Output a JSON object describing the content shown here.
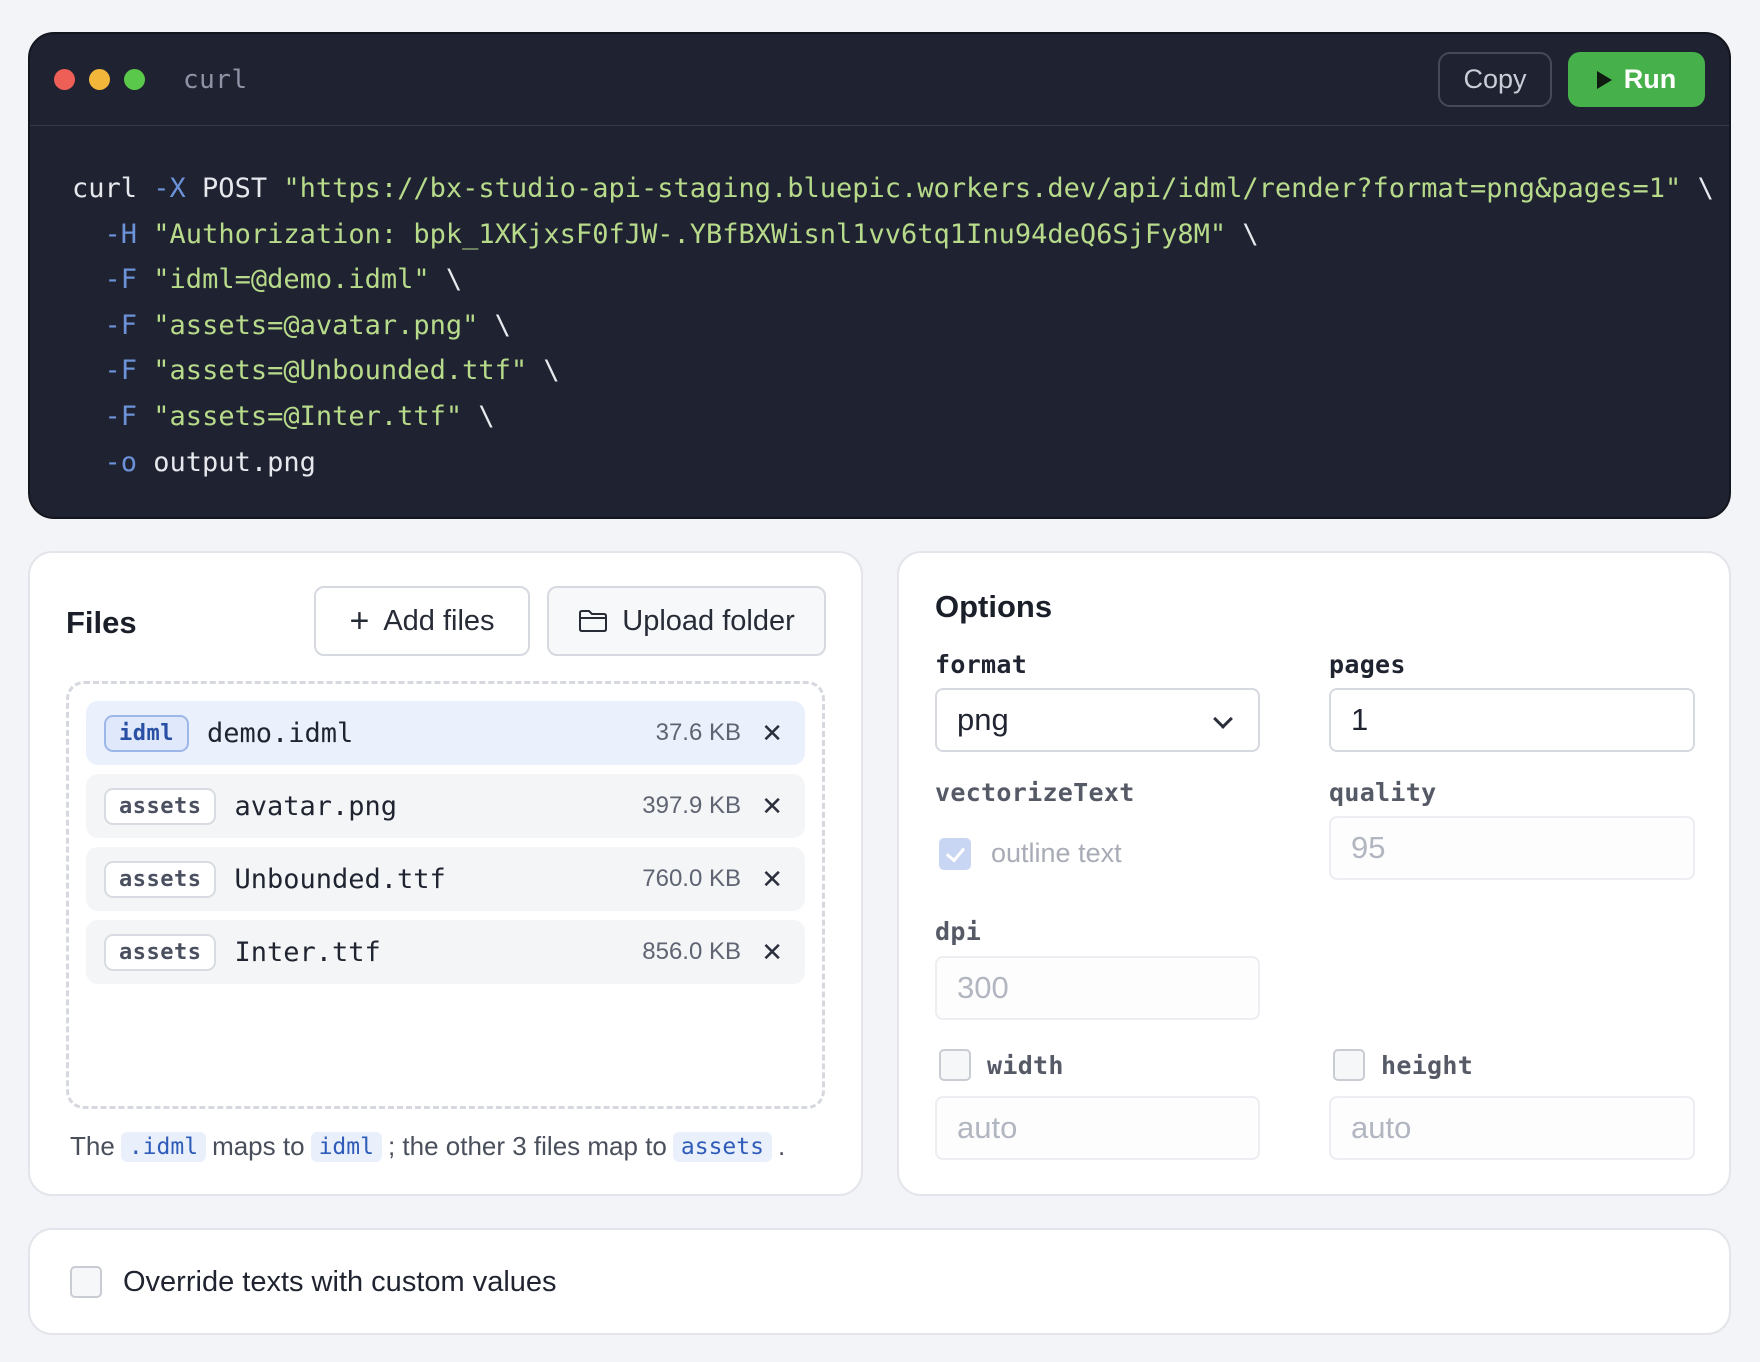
{
  "terminal": {
    "title": "curl",
    "copy_label": "Copy",
    "run_label": "Run",
    "code_lines": [
      [
        {
          "t": "curl ",
          "c": "plain"
        },
        {
          "t": "-X",
          "c": "flag"
        },
        {
          "t": " POST ",
          "c": "plain"
        },
        {
          "t": "\"https://bx-studio-api-staging.bluepic.workers.dev/api/idml/render?format=png&pages=1\"",
          "c": "str"
        },
        {
          "t": " \\",
          "c": "plain"
        }
      ],
      [
        {
          "t": "  ",
          "c": "plain"
        },
        {
          "t": "-H",
          "c": "flag"
        },
        {
          "t": " ",
          "c": "plain"
        },
        {
          "t": "\"Authorization: bpk_1XKjxsF0fJW-.YBfBXWisnl1vv6tq1Inu94deQ6SjFy8M\"",
          "c": "str"
        },
        {
          "t": " \\",
          "c": "plain"
        }
      ],
      [
        {
          "t": "  ",
          "c": "plain"
        },
        {
          "t": "-F",
          "c": "flag"
        },
        {
          "t": " ",
          "c": "plain"
        },
        {
          "t": "\"idml=@demo.idml\"",
          "c": "str"
        },
        {
          "t": " \\",
          "c": "plain"
        }
      ],
      [
        {
          "t": "  ",
          "c": "plain"
        },
        {
          "t": "-F",
          "c": "flag"
        },
        {
          "t": " ",
          "c": "plain"
        },
        {
          "t": "\"assets=@avatar.png\"",
          "c": "str"
        },
        {
          "t": " \\",
          "c": "plain"
        }
      ],
      [
        {
          "t": "  ",
          "c": "plain"
        },
        {
          "t": "-F",
          "c": "flag"
        },
        {
          "t": " ",
          "c": "plain"
        },
        {
          "t": "\"assets=@Unbounded.ttf\"",
          "c": "str"
        },
        {
          "t": " \\",
          "c": "plain"
        }
      ],
      [
        {
          "t": "  ",
          "c": "plain"
        },
        {
          "t": "-F",
          "c": "flag"
        },
        {
          "t": " ",
          "c": "plain"
        },
        {
          "t": "\"assets=@Inter.ttf\"",
          "c": "str"
        },
        {
          "t": " \\",
          "c": "plain"
        }
      ],
      [
        {
          "t": "  ",
          "c": "plain"
        },
        {
          "t": "-o",
          "c": "flag"
        },
        {
          "t": " output.png",
          "c": "plain"
        }
      ]
    ]
  },
  "files": {
    "title": "Files",
    "add_label": "Add files",
    "upload_label": "Upload folder",
    "items": [
      {
        "badge": "idml",
        "name": "demo.idml",
        "size": "37.6 KB"
      },
      {
        "badge": "assets",
        "name": "avatar.png",
        "size": "397.9 KB"
      },
      {
        "badge": "assets",
        "name": "Unbounded.ttf",
        "size": "760.0 KB"
      },
      {
        "badge": "assets",
        "name": "Inter.ttf",
        "size": "856.0 KB"
      }
    ],
    "note": {
      "p1": "The",
      "c1": ".idml",
      "p2": "maps to",
      "c2": "idml",
      "p3": "; the other 3 files map to",
      "c3": "assets",
      "p4": "."
    }
  },
  "options": {
    "title": "Options",
    "format_label": "format",
    "format_value": "png",
    "pages_label": "pages",
    "pages_value": "1",
    "vectorize_label": "vectorizeText",
    "vectorize_text": "outline text",
    "vectorize_checked": true,
    "quality_label": "quality",
    "quality_placeholder": "95",
    "dpi_label": "dpi",
    "dpi_placeholder": "300",
    "width_label": "width",
    "width_placeholder": "auto",
    "width_checked": false,
    "height_label": "height",
    "height_placeholder": "auto",
    "height_checked": false
  },
  "override": {
    "label": "Override texts with custom values",
    "checked": false
  },
  "colors": {
    "run": "#46b14a",
    "terminal_bg": "#1f2230",
    "flag": "#6c93d9",
    "string": "#b7db8a"
  }
}
